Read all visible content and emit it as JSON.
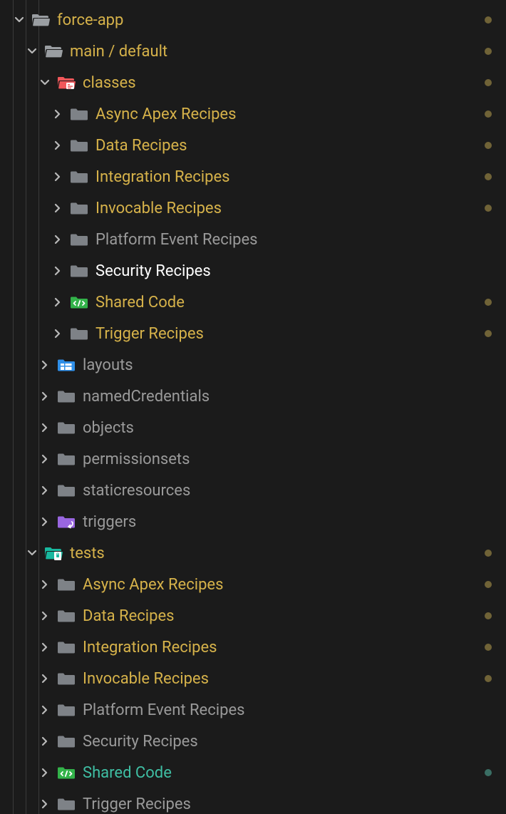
{
  "colors": {
    "modified": "#d6b24a",
    "untracked": "#3fbfa4",
    "default": "#9a9a9a",
    "selected": "#ffffff",
    "chevron": "#b9b9b9",
    "grayFolder": "#7e8287",
    "grayFolderOpen": "#9a9ea2",
    "redFolder": "#f0575a",
    "greenFolder": "#33b34a",
    "blueFolder": "#2f8fe8",
    "purpleFolder": "#9966e0",
    "tealFolder": "#18b89f",
    "dotYellow": "#706337",
    "dotTeal": "#3a6e64"
  },
  "rows": [
    {
      "id": "force-app",
      "indent": 0,
      "expanded": true,
      "folderKind": "open-gray",
      "label": "force-app",
      "labelColor": "modified",
      "dot": "yellow"
    },
    {
      "id": "main-default",
      "indent": 1,
      "expanded": true,
      "folderKind": "open-gray",
      "label": "main / default",
      "labelColor": "modified",
      "dot": "yellow"
    },
    {
      "id": "classes",
      "indent": 2,
      "expanded": true,
      "folderKind": "classes-red",
      "label": "classes",
      "labelColor": "modified",
      "dot": "yellow"
    },
    {
      "id": "classes-async",
      "indent": 3,
      "expanded": false,
      "folderKind": "closed-gray",
      "label": "Async Apex Recipes",
      "labelColor": "modified",
      "dot": "yellow"
    },
    {
      "id": "classes-data",
      "indent": 3,
      "expanded": false,
      "folderKind": "closed-gray",
      "label": "Data Recipes",
      "labelColor": "modified",
      "dot": "yellow"
    },
    {
      "id": "classes-integration",
      "indent": 3,
      "expanded": false,
      "folderKind": "closed-gray",
      "label": "Integration Recipes",
      "labelColor": "modified",
      "dot": "yellow"
    },
    {
      "id": "classes-invocable",
      "indent": 3,
      "expanded": false,
      "folderKind": "closed-gray",
      "label": "Invocable Recipes",
      "labelColor": "modified",
      "dot": "yellow"
    },
    {
      "id": "classes-platform-event",
      "indent": 3,
      "expanded": false,
      "folderKind": "closed-gray",
      "label": "Platform Event Recipes",
      "labelColor": "default",
      "dot": null
    },
    {
      "id": "classes-security",
      "indent": 3,
      "expanded": false,
      "folderKind": "closed-gray",
      "label": "Security Recipes",
      "labelColor": "selected",
      "dot": null
    },
    {
      "id": "classes-shared-code",
      "indent": 3,
      "expanded": false,
      "folderKind": "code-green",
      "label": "Shared Code",
      "labelColor": "modified",
      "dot": "yellow"
    },
    {
      "id": "classes-trigger",
      "indent": 3,
      "expanded": false,
      "folderKind": "closed-gray",
      "label": "Trigger Recipes",
      "labelColor": "modified",
      "dot": "yellow"
    },
    {
      "id": "layouts",
      "indent": 2,
      "expanded": false,
      "folderKind": "layouts-blue",
      "label": "layouts",
      "labelColor": "default",
      "dot": null
    },
    {
      "id": "named-credentials",
      "indent": 2,
      "expanded": false,
      "folderKind": "closed-gray",
      "label": "namedCredentials",
      "labelColor": "default",
      "dot": null
    },
    {
      "id": "objects",
      "indent": 2,
      "expanded": false,
      "folderKind": "closed-gray",
      "label": "objects",
      "labelColor": "default",
      "dot": null
    },
    {
      "id": "permissionsets",
      "indent": 2,
      "expanded": false,
      "folderKind": "closed-gray",
      "label": "permissionsets",
      "labelColor": "default",
      "dot": null
    },
    {
      "id": "staticresources",
      "indent": 2,
      "expanded": false,
      "folderKind": "closed-gray",
      "label": "staticresources",
      "labelColor": "default",
      "dot": null
    },
    {
      "id": "triggers",
      "indent": 2,
      "expanded": false,
      "folderKind": "triggers-purple",
      "label": "triggers",
      "labelColor": "default",
      "dot": null
    },
    {
      "id": "tests",
      "indent": 1,
      "expanded": true,
      "folderKind": "tests-teal",
      "label": "tests",
      "labelColor": "modified",
      "dot": "yellow"
    },
    {
      "id": "tests-async",
      "indent": 2,
      "expanded": false,
      "folderKind": "closed-gray",
      "label": "Async Apex Recipes",
      "labelColor": "modified",
      "dot": "yellow"
    },
    {
      "id": "tests-data",
      "indent": 2,
      "expanded": false,
      "folderKind": "closed-gray",
      "label": "Data Recipes",
      "labelColor": "modified",
      "dot": "yellow"
    },
    {
      "id": "tests-integration",
      "indent": 2,
      "expanded": false,
      "folderKind": "closed-gray",
      "label": "Integration Recipes",
      "labelColor": "modified",
      "dot": "yellow"
    },
    {
      "id": "tests-invocable",
      "indent": 2,
      "expanded": false,
      "folderKind": "closed-gray",
      "label": "Invocable Recipes",
      "labelColor": "modified",
      "dot": "yellow"
    },
    {
      "id": "tests-platform-event",
      "indent": 2,
      "expanded": false,
      "folderKind": "closed-gray",
      "label": "Platform Event Recipes",
      "labelColor": "default",
      "dot": null
    },
    {
      "id": "tests-security",
      "indent": 2,
      "expanded": false,
      "folderKind": "closed-gray",
      "label": "Security Recipes",
      "labelColor": "default",
      "dot": null
    },
    {
      "id": "tests-shared-code",
      "indent": 2,
      "expanded": false,
      "folderKind": "code-green",
      "label": "Shared Code",
      "labelColor": "untracked",
      "dot": "teal"
    },
    {
      "id": "tests-trigger",
      "indent": 2,
      "expanded": false,
      "folderKind": "closed-gray",
      "label": "Trigger Recipes",
      "labelColor": "default",
      "dot": null
    }
  ]
}
